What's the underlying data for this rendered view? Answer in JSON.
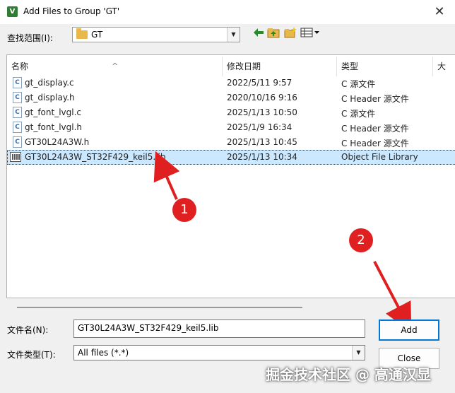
{
  "window": {
    "title": "Add Files to Group 'GT'",
    "app_icon_glyph": "V",
    "close_glyph": "✕"
  },
  "lookin": {
    "label": "查找范围(I):",
    "value": "GT"
  },
  "toolbar": {
    "back_icon": "back-arrow-icon",
    "up_icon": "up-folder-icon",
    "new_folder_icon": "new-folder-icon",
    "view_icon": "view-menu-icon"
  },
  "list": {
    "headers": [
      "名称",
      "修改日期",
      "类型",
      "大"
    ],
    "rows": [
      {
        "name": "gt_display.c",
        "date": "2022/5/11 9:57",
        "type": "C 源文件",
        "icon": "c-source-file-icon",
        "selected": false
      },
      {
        "name": "gt_display.h",
        "date": "2020/10/16 9:16",
        "type": "C Header 源文件",
        "icon": "c-header-file-icon",
        "selected": false
      },
      {
        "name": "gt_font_lvgl.c",
        "date": "2025/1/13 10:50",
        "type": "C 源文件",
        "icon": "c-source-file-icon",
        "selected": false
      },
      {
        "name": "gt_font_lvgl.h",
        "date": "2025/1/9 16:34",
        "type": "C Header 源文件",
        "icon": "c-header-file-icon",
        "selected": false
      },
      {
        "name": "GT30L24A3W.h",
        "date": "2025/1/13 10:45",
        "type": "C Header 源文件",
        "icon": "c-header-file-icon",
        "selected": false
      },
      {
        "name": "GT30L24A3W_ST32F429_keil5.lib",
        "date": "2025/1/13 10:34",
        "type": "Object File Library",
        "icon": "library-file-icon",
        "selected": true
      }
    ]
  },
  "annotations": {
    "marker1": "1",
    "marker2": "2",
    "arrow_color": "#e02020"
  },
  "filename": {
    "label": "文件名(N):",
    "value": "GT30L24A3W_ST32F429_keil5.lib"
  },
  "filetype": {
    "label": "文件类型(T):",
    "value": "All files (*.*)"
  },
  "buttons": {
    "add": "Add",
    "close": "Close"
  },
  "watermark": "掘金技术社区 @ 高通汉显",
  "colors": {
    "selection": "#cce8ff",
    "default_button_border": "#0078d7",
    "marker": "#e02020"
  }
}
